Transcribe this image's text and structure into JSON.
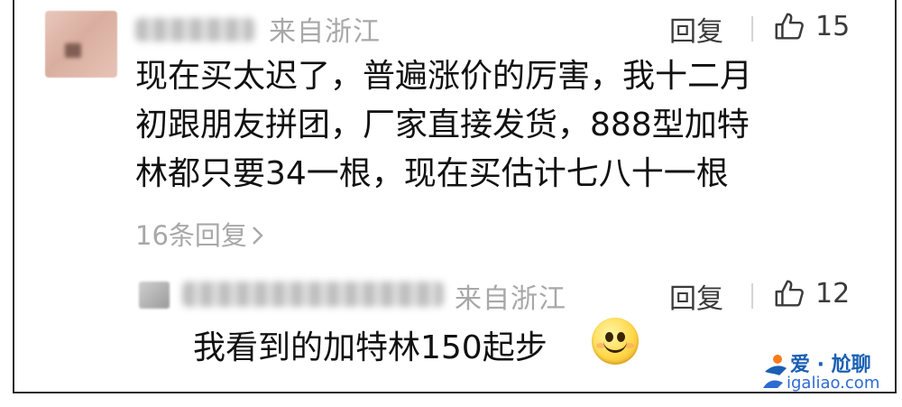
{
  "comment": {
    "location": "来自浙江",
    "reply_label": "回复",
    "like_count": "15",
    "content_lines": [
      "现在买太迟了，普遍涨价的厉害，我十二月",
      "初跟朋友拼团，厂家直接发货，888型加特",
      "林都只要34一根，现在买估计七八十一根"
    ],
    "replies_link": "16条回复"
  },
  "reply": {
    "location": "来自浙江",
    "reply_label": "回复",
    "like_count": "12",
    "content": "我看到的加特林150起步"
  },
  "watermark": {
    "title": "爱 · 尬聊",
    "url": "igaliao.com"
  },
  "icons": {
    "like": "thumbs-up-icon",
    "chevron": "chevron-right-icon",
    "emoji": "smiley-face-icon",
    "watermark_logo": "igaliao-logo-icon"
  },
  "colors": {
    "meta_gray": "#a8a8a8",
    "action_dark": "#3b3b3b",
    "watermark_blue": "#1a5fb4"
  }
}
